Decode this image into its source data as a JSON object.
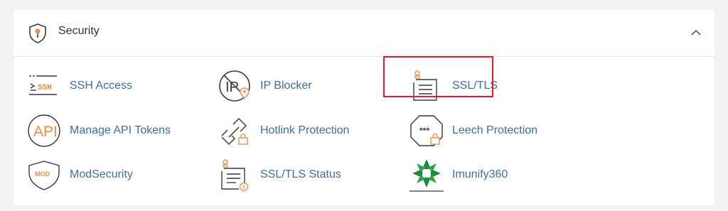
{
  "section": {
    "title": "Security",
    "header_icon": "shield-icon",
    "collapse_icon": "chevron-up-icon"
  },
  "items": [
    {
      "label": "SSH Access",
      "icon": "ssh-terminal-icon"
    },
    {
      "label": "IP Blocker",
      "icon": "ip-blocker-icon"
    },
    {
      "label": "SSL/TLS",
      "icon": "ssl-certificate-icon"
    },
    {
      "label": "Manage API Tokens",
      "icon": "api-icon"
    },
    {
      "label": "Hotlink Protection",
      "icon": "hotlink-icon"
    },
    {
      "label": "Leech Protection",
      "icon": "leech-protection-icon"
    },
    {
      "label": "ModSecurity",
      "icon": "modsecurity-shield-icon"
    },
    {
      "label": "SSL/TLS Status",
      "icon": "ssl-status-icon"
    },
    {
      "label": "Imunify360",
      "icon": "imunify360-icon"
    }
  ],
  "colors": {
    "link": "#3d6fa6",
    "icon_stroke": "#3a3a3a",
    "icon_accent": "#f08a3c",
    "highlight_border": "#e81e1e",
    "imunify_green": "#1f8a3b"
  }
}
